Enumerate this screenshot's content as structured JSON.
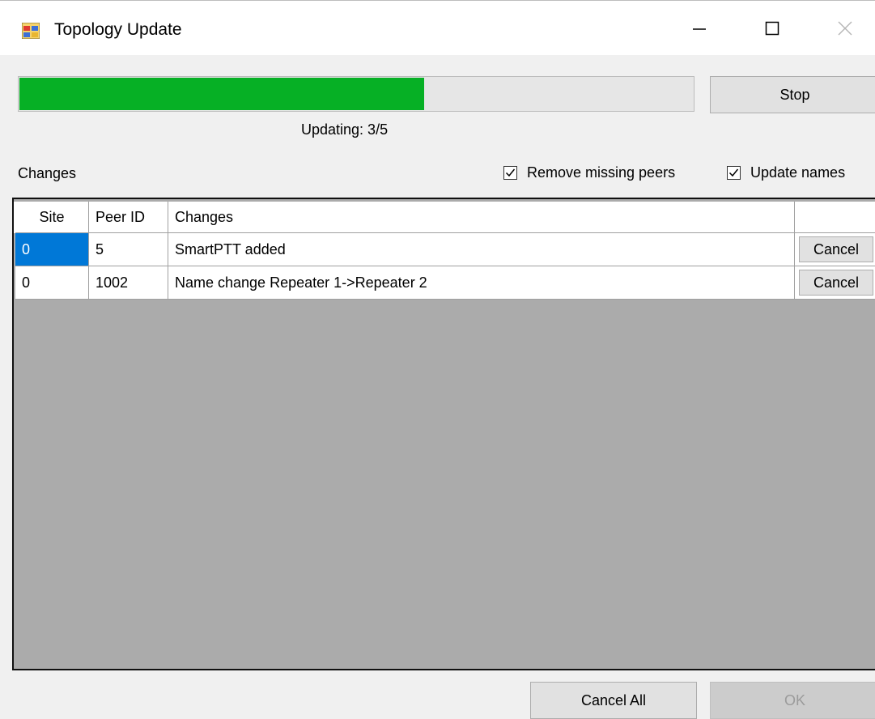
{
  "window": {
    "title": "Topology Update",
    "minimize_glyph": "—",
    "maximize_glyph": "☐",
    "close_glyph": "✕"
  },
  "progress": {
    "value": 0.6,
    "status_text": "Updating: 3/5",
    "fill_color": "#06b025"
  },
  "buttons": {
    "stop": "Stop",
    "cancel_all": "Cancel All",
    "ok": "OK"
  },
  "changes_label": "Changes",
  "options": {
    "remove_missing_peers": {
      "label": "Remove missing peers",
      "checked": true
    },
    "update_names": {
      "label": "Update names",
      "checked": true
    }
  },
  "grid": {
    "columns": [
      "Site",
      "Peer ID",
      "Changes",
      ""
    ],
    "rows": [
      {
        "site": "0",
        "peer_id": "5",
        "changes": "SmartPTT added",
        "action": "Cancel"
      },
      {
        "site": "0",
        "peer_id": "1002",
        "changes": "Name change Repeater 1->Repeater 2",
        "action": "Cancel"
      }
    ]
  },
  "colors": {
    "selection": "#0078d7",
    "grid_background": "#ababab"
  }
}
